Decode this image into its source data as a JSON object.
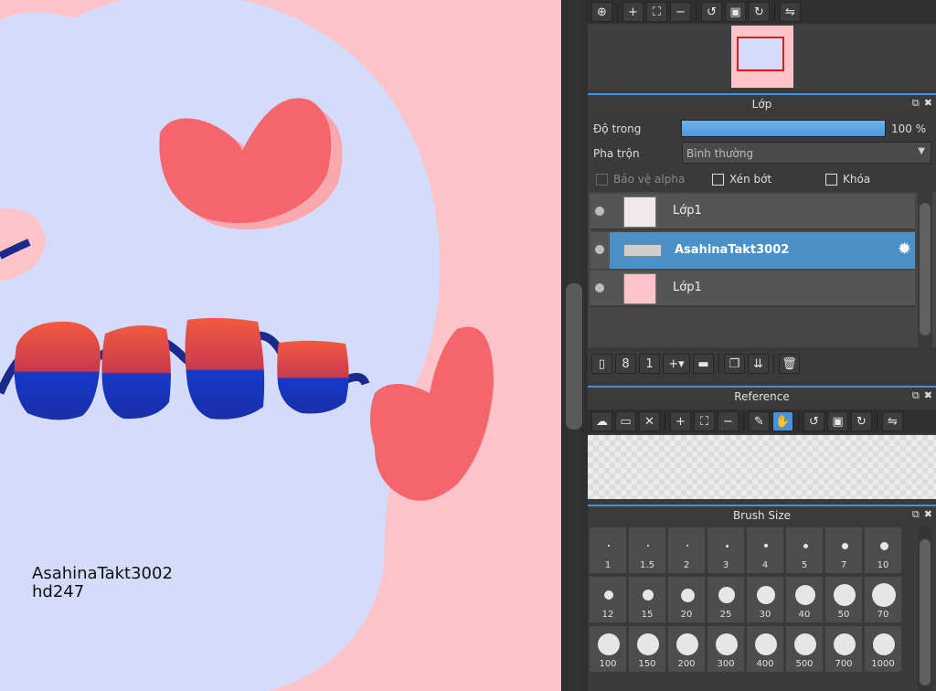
{
  "canvas": {
    "watermark_line1": "AsahinaTakt3002",
    "watermark_line2": "hd247"
  },
  "navigator": {
    "icons": [
      "zoom-fit-icon",
      "zoom-in-icon",
      "fit-screen-icon",
      "zoom-out-icon",
      "rotate-left-icon",
      "reset-view-icon",
      "rotate-right-icon",
      "flip-icon"
    ]
  },
  "layer_panel": {
    "title": "Lớp",
    "opacity_label": "Độ trong",
    "opacity_value": 100,
    "opacity_text": "100 %",
    "blend_label": "Pha trộn",
    "blend_value": "Bình thường",
    "protect_alpha": "Bảo vệ alpha",
    "clipping": "Xén bớt",
    "lock": "Khóa",
    "layers": [
      {
        "name": "Lớp1",
        "selected": false
      },
      {
        "name": "AsahinaTakt3002",
        "selected": true
      },
      {
        "name": "Lớp1",
        "selected": false
      }
    ]
  },
  "reference_panel": {
    "title": "Reference"
  },
  "brush_panel": {
    "title": "Brush Size",
    "sizes": [
      "1",
      "1.5",
      "2",
      "3",
      "4",
      "5",
      "7",
      "10",
      "12",
      "15",
      "20",
      "25",
      "30",
      "40",
      "50",
      "70",
      "100",
      "150",
      "200",
      "300",
      "400",
      "500",
      "700",
      "1000"
    ]
  },
  "colors": {
    "canvas_pink": "#fcc3c8",
    "canvas_blue": "#d5dcfb",
    "heart": "#f4656d",
    "accent": "#4a90d9",
    "navy": "#1a2a8c"
  }
}
